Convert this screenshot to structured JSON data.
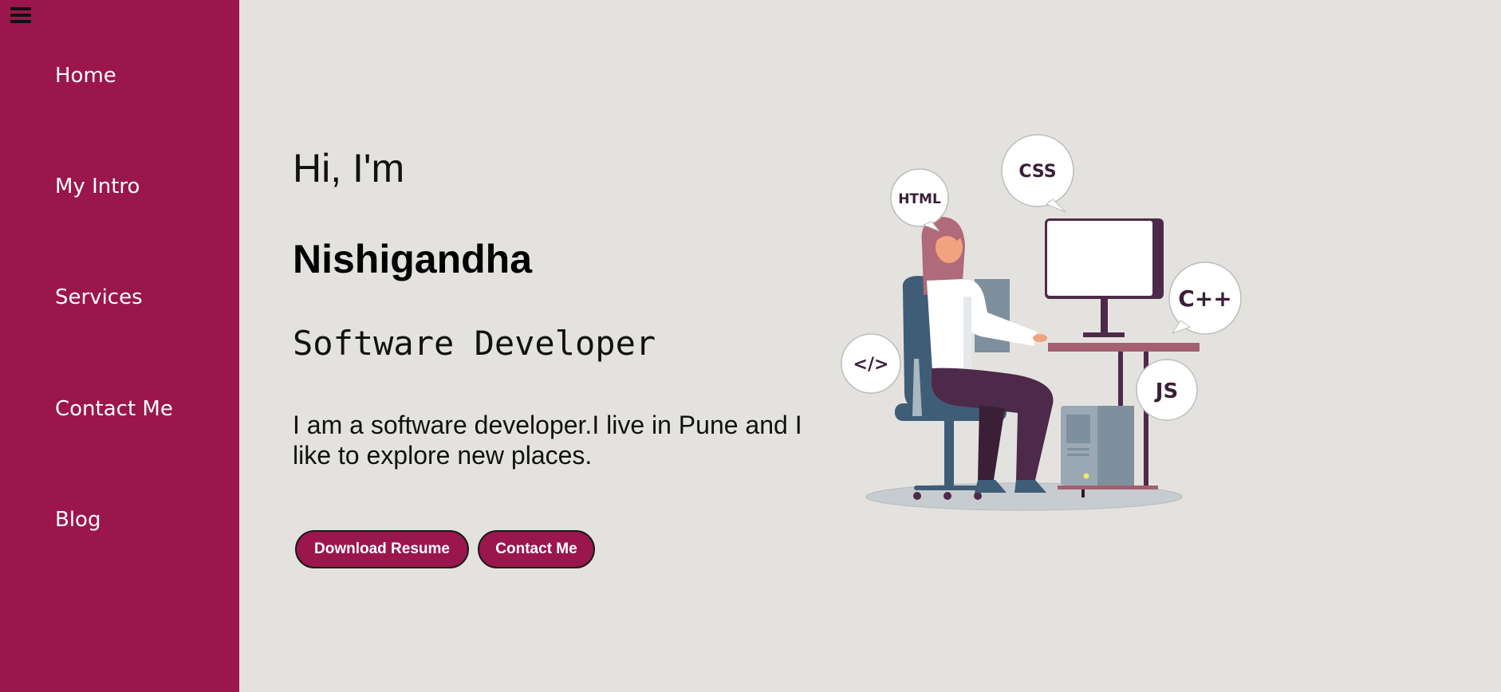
{
  "sidebar": {
    "items": [
      {
        "label": "Home"
      },
      {
        "label": "My Intro"
      },
      {
        "label": "Services"
      },
      {
        "label": "Contact Me"
      },
      {
        "label": "Blog"
      }
    ]
  },
  "hero": {
    "greeting": "Hi, I'm",
    "name": "Nishigandha",
    "role": "Software Developer",
    "bio": "I am a software developer.I live in Pune and I like to explore new places.",
    "buttons": {
      "download": "Download Resume",
      "contact": "Contact Me"
    }
  },
  "illustration": {
    "bubbles": [
      "HTML",
      "CSS",
      "C++",
      "</>",
      "JS"
    ]
  },
  "colors": {
    "sidebar": "#9b164d",
    "background": "#e4e2df",
    "button": "#9b164d"
  }
}
